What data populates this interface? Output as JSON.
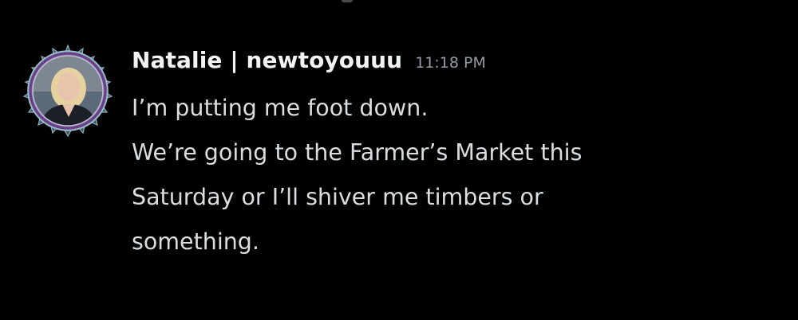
{
  "message": {
    "author": "Natalie | newtoyouuu",
    "timestamp": "11:18 PM",
    "avatar": {
      "icon": "user-avatar-photo",
      "frame": "ornate-decoration-frame",
      "frame_color": "#7fa8b8",
      "accent_color": "#6e3a8a"
    },
    "lines": [
      "I’m putting me foot down.",
      "We’re going to the Farmer’s Market this",
      "Saturday or I’ll shiver me timbers or",
      "something."
    ]
  },
  "colors": {
    "background": "#000000",
    "username": "#f2f3f5",
    "timestamp": "#949ba4",
    "text": "#dbdee1"
  }
}
